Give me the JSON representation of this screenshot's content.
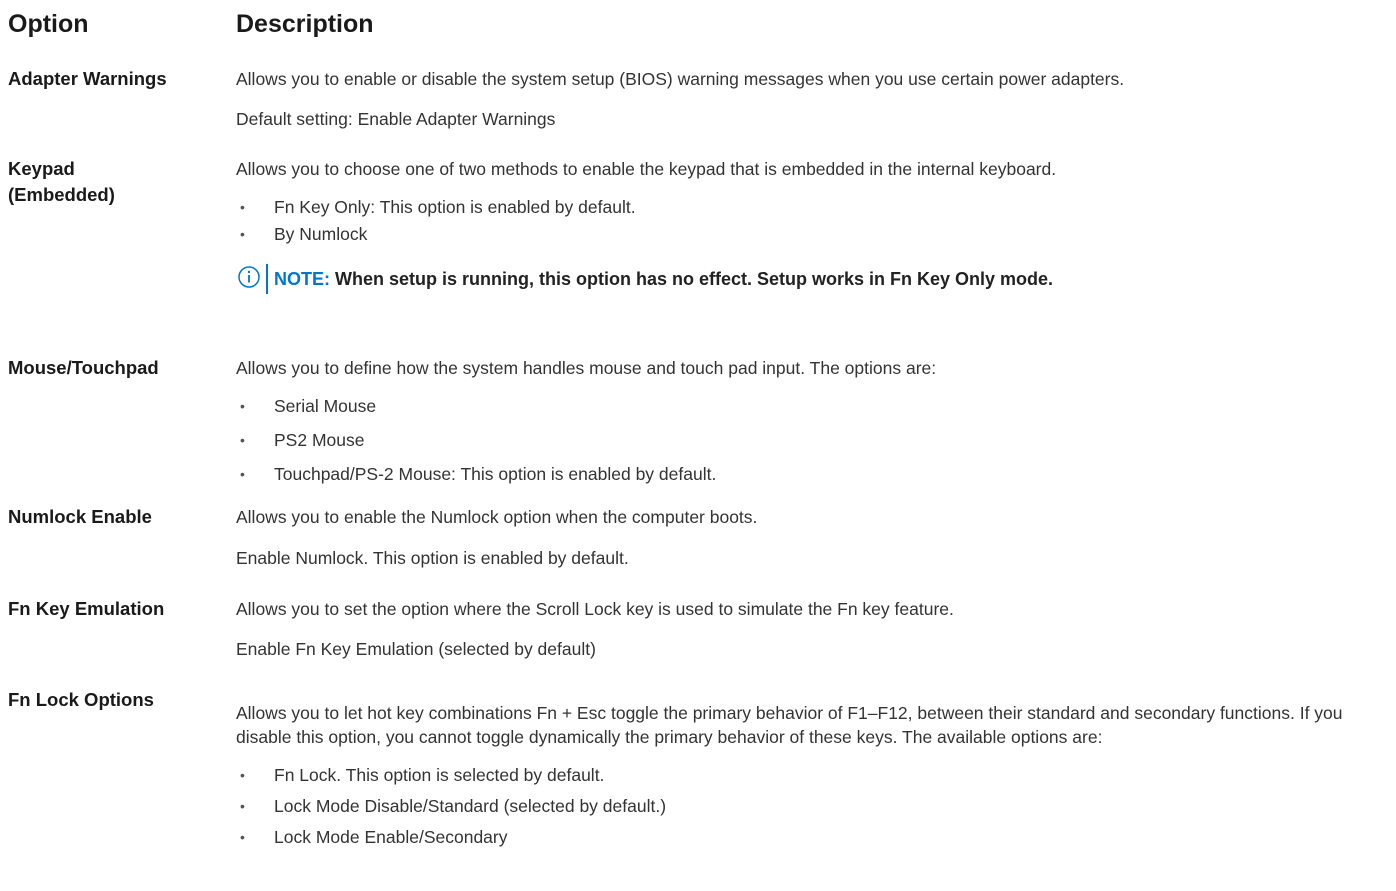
{
  "header": {
    "option": "Option",
    "description": "Description"
  },
  "rows": [
    {
      "name": "Adapter Warnings",
      "paragraphs": [
        "Allows you to enable or disable the system setup (BIOS) warning messages when you use certain power adapters.",
        "Default setting: Enable Adapter Warnings"
      ]
    },
    {
      "name_line1": "Keypad",
      "name_line2": "(Embedded)",
      "paragraphs": [
        "Allows you to choose one of two methods to enable the keypad that is embedded in the internal keyboard."
      ],
      "bullets": [
        "Fn Key Only: This option is enabled by default.",
        "By Numlock"
      ],
      "note": {
        "label": "NOTE:",
        "text": " When setup is running, this option has no effect. Setup works in Fn Key Only mode."
      }
    },
    {
      "name": "Mouse/Touchpad",
      "paragraphs": [
        "Allows you to define how the system handles mouse and touch pad input. The options are:"
      ],
      "bullets": [
        "Serial Mouse",
        "PS2 Mouse",
        "Touchpad/PS-2 Mouse: This option is enabled by default."
      ]
    },
    {
      "name": "Numlock Enable",
      "paragraphs": [
        "Allows you to enable the Numlock option when the computer boots.",
        "Enable Numlock. This option is enabled by default."
      ]
    },
    {
      "name": "Fn Key Emulation",
      "paragraphs": [
        "Allows you to set the option where the Scroll Lock key is used to simulate the Fn key feature.",
        "Enable Fn Key Emulation (selected by default)"
      ]
    },
    {
      "name": "Fn Lock Options",
      "paragraphs": [
        "Allows you to let hot key combinations Fn + Esc toggle the primary behavior of F1–F12, between their standard and secondary functions. If you disable this option, you cannot toggle dynamically the primary behavior of these keys. The available options are:"
      ],
      "bullets": [
        "Fn Lock. This option is selected by default.",
        "Lock Mode Disable/Standard (selected by default.)",
        "Lock Mode Enable/Secondary"
      ]
    }
  ],
  "colors": {
    "accent": "#0076ce",
    "text": "#333333"
  },
  "icons": {
    "note": "info-icon",
    "bullet": "bullet-dot"
  }
}
